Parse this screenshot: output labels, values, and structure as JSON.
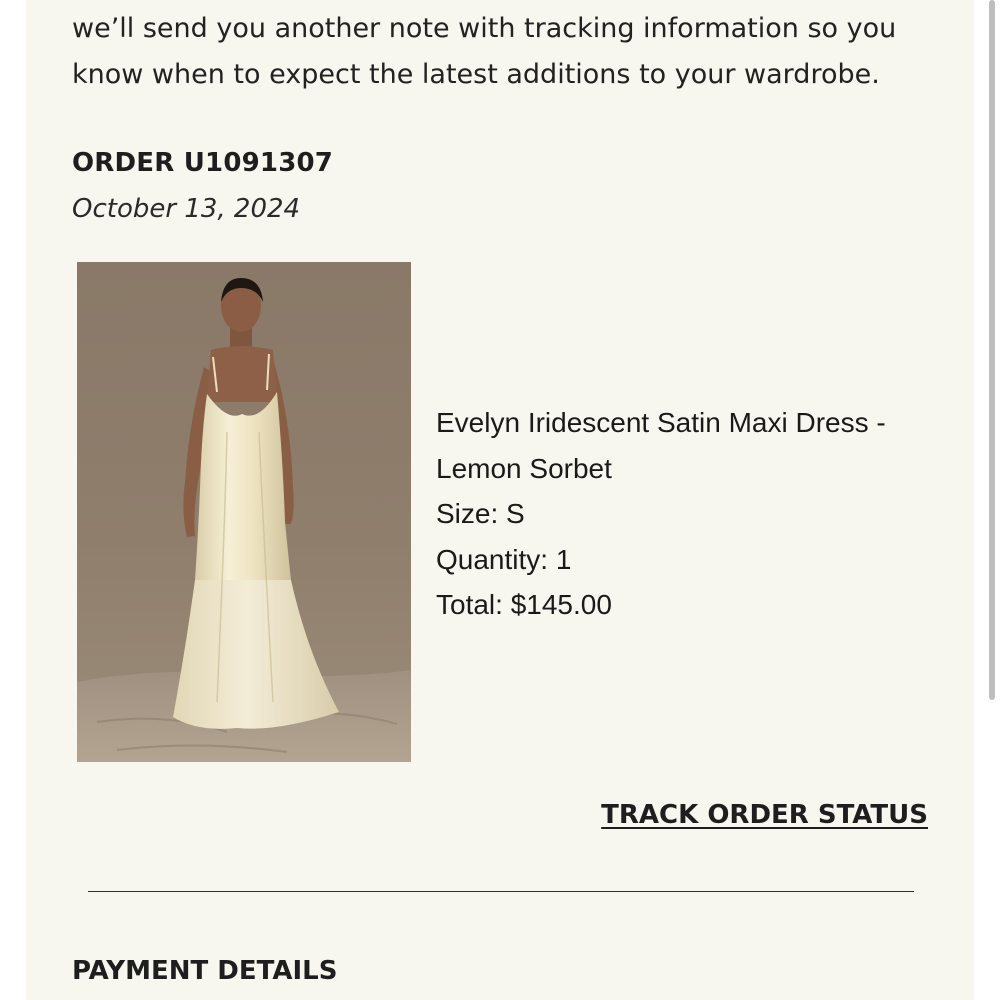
{
  "email": {
    "intro_text": "we’ll send you another note with tracking information so you know when to expect the latest additions to your wardrobe.",
    "order_number": "ORDER U1091307",
    "order_date": "October 13, 2024"
  },
  "product": {
    "name": "Evelyn Iridescent Satin Maxi Dress - Lemon Sorbet",
    "size": "Size: S",
    "quantity": "Quantity: 1",
    "total": "Total: $145.00",
    "image_alt": "Model wearing a cream satin slip maxi dress"
  },
  "actions": {
    "track_order_label": "TRACK ORDER STATUS"
  },
  "payment": {
    "heading": "PAYMENT DETAILS"
  },
  "colors": {
    "card_background": "#f7f6ef",
    "text": "#1e1e1e",
    "photo_backdrop": "#8c7b6b",
    "dress": "#efe6c6"
  }
}
